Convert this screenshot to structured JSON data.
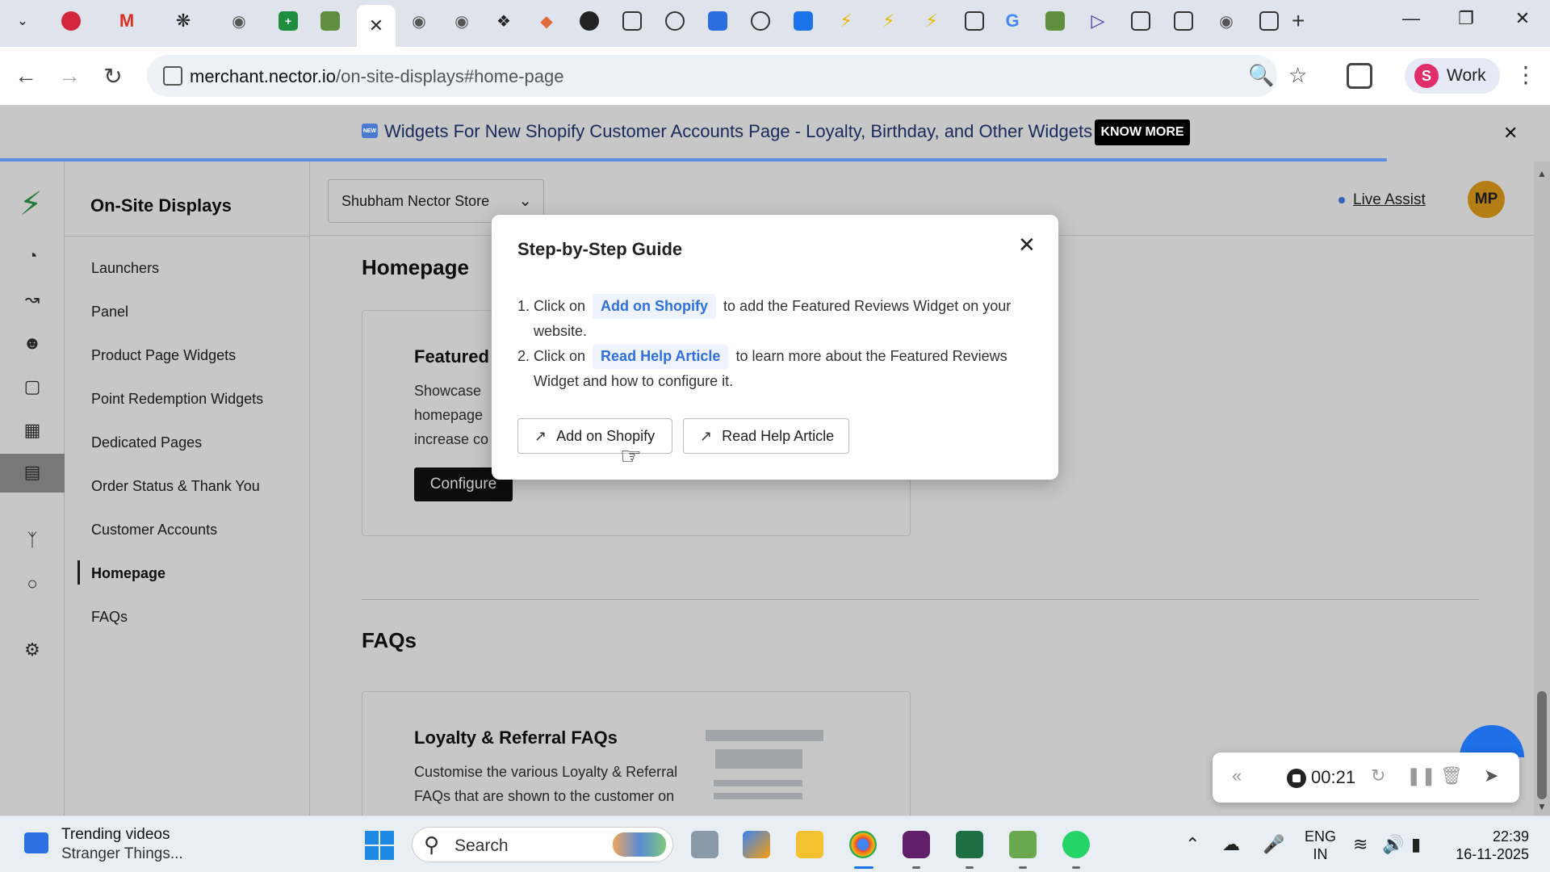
{
  "browser": {
    "url_host": "merchant.nector.io",
    "url_path": "/on-site-displays#home-page",
    "profile_initial": "S",
    "profile_label": "Work",
    "active_tab_icon": "close-icon"
  },
  "banner": {
    "text": "Widgets For New Shopify Customer Accounts Page - Loyalty, Birthday, and Other Widgets",
    "button": "KNOW MORE",
    "badge": "NEW"
  },
  "sidebar": {
    "title": "On-Site Displays",
    "items": [
      {
        "label": "Launchers"
      },
      {
        "label": "Panel"
      },
      {
        "label": "Product Page Widgets"
      },
      {
        "label": "Point Redemption Widgets"
      },
      {
        "label": "Dedicated Pages"
      },
      {
        "label": "Order Status & Thank You"
      },
      {
        "label": "Customer Accounts"
      },
      {
        "label": "Homepage"
      },
      {
        "label": "FAQs"
      }
    ],
    "active": "Homepage"
  },
  "topbar": {
    "store": "Shubham Nector Store",
    "live_assist": "Live Assist",
    "avatar": "MP"
  },
  "content": {
    "homepage_title": "Homepage",
    "featured_card": {
      "title": "Featured",
      "desc_lines": [
        "Showcase",
        "homepage",
        "increase co"
      ],
      "button": "Configure"
    },
    "faqs_title": "FAQs",
    "faq_card": {
      "title": "Loyalty & Referral FAQs",
      "desc": "Customise the various Loyalty & Referral FAQs that are shown to the customer on"
    }
  },
  "modal": {
    "title": "Step-by-Step Guide",
    "step1_num": "1.",
    "step1_pre": "Click on",
    "step1_chip": "Add on Shopify",
    "step1_post": "to add the Featured Reviews Widget on your website.",
    "step2_num": "2.",
    "step2_pre": "Click on",
    "step2_chip": "Read Help Article",
    "step2_post": "to learn more about the Featured Reviews Widget and how to configure it.",
    "btn_add": "Add on Shopify",
    "btn_read": "Read Help Article"
  },
  "recorder": {
    "time": "00:21"
  },
  "taskbar": {
    "news_title": "Trending videos",
    "news_sub": "Stranger Things...",
    "search_placeholder": "Search",
    "lang_top": "ENG",
    "lang_bottom": "IN",
    "time": "22:39",
    "date": "16-11-2025"
  },
  "colors": {
    "brand_green": "#2e9d4a",
    "chip_blue": "#2f6fde",
    "avatar_orange": "#e8a21a"
  }
}
